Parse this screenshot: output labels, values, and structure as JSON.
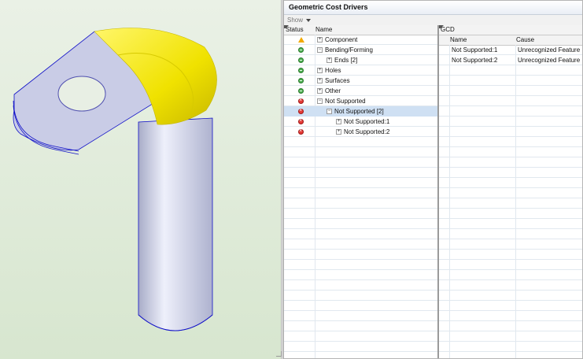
{
  "panel": {
    "title": "Geometric Cost Drivers",
    "show_label": "Show"
  },
  "tree": {
    "headers": {
      "status": "Status",
      "name": "Name"
    },
    "rows": [
      {
        "status": "warning",
        "label": "Component",
        "depth": 0,
        "expander": "+"
      },
      {
        "status": "ok",
        "label": "Bending/Forming",
        "depth": 0,
        "expander": "−"
      },
      {
        "status": "ok",
        "label": "Ends [2]",
        "depth": 1,
        "expander": "+"
      },
      {
        "status": "ok",
        "label": "Holes",
        "depth": 0,
        "expander": "+"
      },
      {
        "status": "ok",
        "label": "Surfaces",
        "depth": 0,
        "expander": "+"
      },
      {
        "status": "ok",
        "label": "Other",
        "depth": 0,
        "expander": "+"
      },
      {
        "status": "error",
        "label": "Not Supported",
        "depth": 0,
        "expander": "−"
      },
      {
        "status": "error",
        "label": "Not Supported [2]",
        "depth": 1,
        "expander": "−",
        "selected": true
      },
      {
        "status": "error",
        "label": "Not Supported:1",
        "depth": 2,
        "expander": "+"
      },
      {
        "status": "error",
        "label": "Not Supported:2",
        "depth": 2,
        "expander": "+"
      }
    ]
  },
  "gcd": {
    "title": "GCD",
    "headers": {
      "name": "Name",
      "cause": "Cause"
    },
    "rows": [
      {
        "name": "Not Supported:1",
        "cause": "Unrecognized Feature"
      },
      {
        "name": "Not Supported:2",
        "cause": "Unrecognized Feature"
      }
    ]
  },
  "colors": {
    "highlight": "#f2e800",
    "part": "#c9cce6",
    "edge": "#1010c8"
  }
}
